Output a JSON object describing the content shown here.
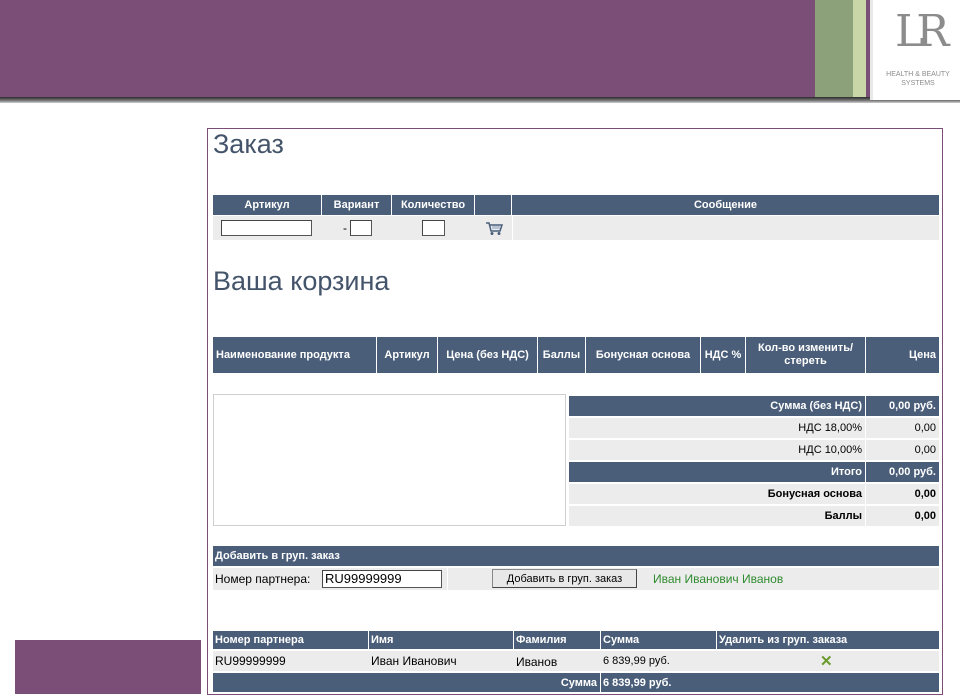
{
  "header": {
    "logo_mark": "LR",
    "logo_text_line1": "HEALTH & BEAUTY",
    "logo_text_line2": "SYSTEMS"
  },
  "order": {
    "title": "Заказ",
    "columns": {
      "article": "Артикул",
      "variant": "Вариант",
      "quantity": "Количество",
      "message": "Сообщение"
    },
    "article_value": "",
    "variant_dash": "-",
    "variant_value": "",
    "quantity_value": "",
    "cart_icon": "cart-icon"
  },
  "cart": {
    "title": "Ваша корзина",
    "columns": {
      "product_name": "Наименование продукта",
      "article": "Артикул",
      "price_no_vat": "Цена (без НДС)",
      "points": "Баллы",
      "bonus_base": "Бонусная основа",
      "vat": "НДС %",
      "qty_edit": "Кол-во изменить/стереть",
      "price": "Цена"
    },
    "summary": {
      "sum_no_vat_label": "Сумма (без НДС)",
      "sum_no_vat_value": "0,00 руб.",
      "vat18_label": "НДС 18,00%",
      "vat18_value": "0,00",
      "vat10_label": "НДС 10,00%",
      "vat10_value": "0,00",
      "total_label": "Итого",
      "total_value": "0,00 руб.",
      "bonus_label": "Бонусная основа",
      "bonus_value": "0,00",
      "points_label": "Баллы",
      "points_value": "0,00"
    }
  },
  "group": {
    "header": "Добавить в груп. заказ",
    "partner_label": "Номер партнера:",
    "partner_value": "RU99999999",
    "add_button": "Добавить в груп. заказ",
    "partner_name": "Иван Иванович Иванов",
    "table": {
      "columns": {
        "partner_no": "Номер партнера",
        "first_name": "Имя",
        "last_name": "Фамилия",
        "sum": "Сумма",
        "delete": "Удалить из груп. заказа"
      },
      "rows": [
        {
          "partner_no": "RU99999999",
          "first_name": "Иван Иванович",
          "last_name": "Иванов",
          "sum": "6 839,99 руб.",
          "delete_icon": "✕"
        }
      ],
      "total_label": "Сумма",
      "total_value": "6 839,99 руб."
    }
  },
  "colors": {
    "brand_purple": "#7b4e78",
    "header_blue": "#4a5e79",
    "accent_green": "#2e8b2e"
  }
}
